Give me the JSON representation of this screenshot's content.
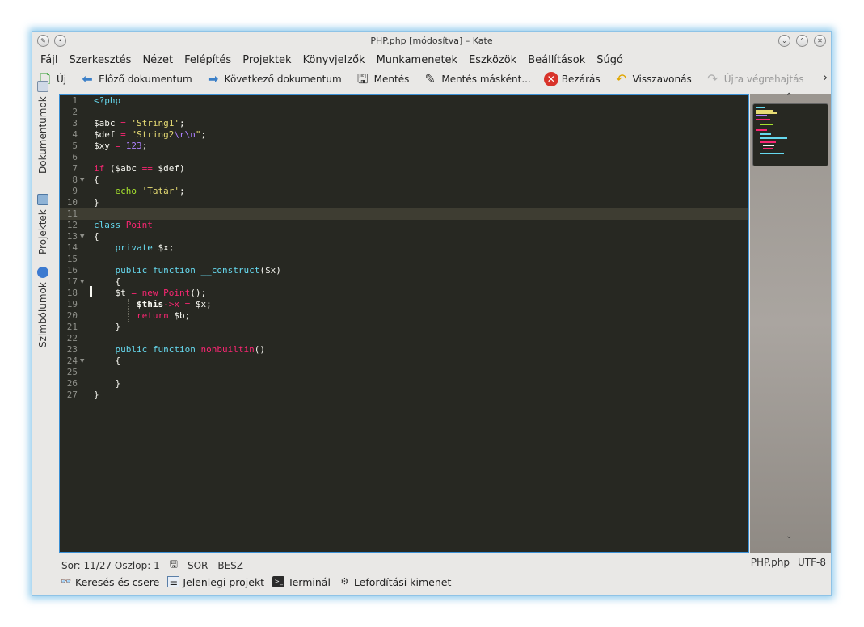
{
  "window": {
    "title": "PHP.php [módosítva] – Kate"
  },
  "menu": [
    "Fájl",
    "Szerkesztés",
    "Nézet",
    "Felépítés",
    "Projektek",
    "Könyvjelzők",
    "Munkamenetek",
    "Eszközök",
    "Beállítások",
    "Súgó"
  ],
  "toolbar": {
    "new": "Új",
    "prev_doc": "Előző dokumentum",
    "next_doc": "Következő dokumentum",
    "save": "Mentés",
    "save_as": "Mentés másként...",
    "close": "Bezárás",
    "undo": "Visszavonás",
    "redo": "Újra végrehajtás",
    "more": "›"
  },
  "sidebar": {
    "tabs": [
      "Dokumentumok",
      "Projektek",
      "Szimbólumok"
    ]
  },
  "editor": {
    "current_line": 11,
    "lines": [
      "<?php",
      "",
      "$abc = 'String1';",
      "$def = \"String2\\r\\n\";",
      "$xy = 123;",
      "",
      "if ($abc == $def)",
      "{",
      "    echo 'Tatár';",
      "}",
      "",
      "class Point",
      "{",
      "    private $x;",
      "",
      "    public function __construct($x)",
      "    {",
      "    $t = new Point();",
      "        $this->x = $x;",
      "        return $b;",
      "    }",
      "",
      "    public function nonbuiltin()",
      "    {",
      "",
      "    }",
      "}"
    ]
  },
  "status": {
    "position": "Sor: 11/27 Oszlop: 1",
    "mode": "SOR",
    "insert": "BESZ",
    "filename": "PHP.php",
    "encoding": "UTF-8"
  },
  "bottom_tabs": [
    "Keresés és csere",
    "Jelenlegi projekt",
    "Terminál",
    "Lefordítási kimenet"
  ],
  "colors": {
    "editor_bg": "#272822",
    "accent": "#3a8fd4",
    "keyword": "#f92672",
    "string": "#e6db74",
    "number": "#ae81ff",
    "function": "#66d9ef"
  }
}
